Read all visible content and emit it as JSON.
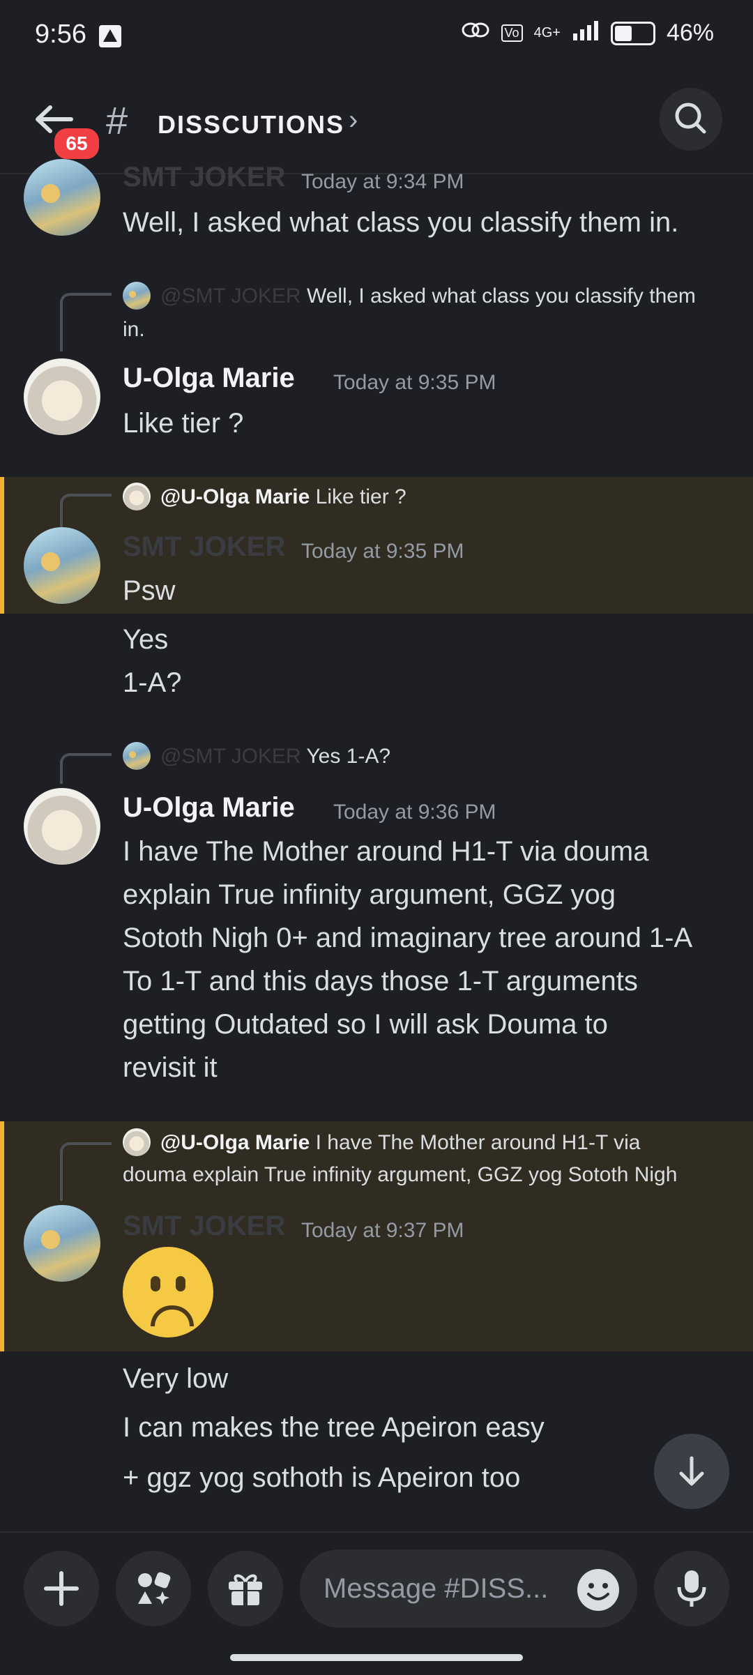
{
  "status_bar": {
    "time": "9:56",
    "network": "4G+",
    "battery_pct": "46%",
    "battery_level": 0.46
  },
  "header": {
    "channel": "DISSCUTIONS",
    "unread_badge": "65",
    "hash": "#"
  },
  "messages": [
    {
      "author": "SMT JOKER",
      "time": "Today at 9:34 PM",
      "lines": [
        "Well, I asked what class you classify them in."
      ]
    },
    {
      "reply_to": "@SMT JOKER",
      "reply_text": "Well, I asked what class you classify them",
      "reply_text2": "in.",
      "author": "U-Olga Marie",
      "time": "Today at 9:35 PM",
      "lines": [
        "Like tier ?"
      ]
    },
    {
      "reply_to": "@U-Olga Marie",
      "reply_text": "Like tier ?",
      "author": "SMT JOKER",
      "time": "Today at 9:35 PM",
      "lines": [
        "Psw",
        "Yes",
        "1-A?"
      ]
    },
    {
      "reply_to": "@SMT JOKER",
      "reply_text": "Yes 1-A?",
      "author": "U-Olga Marie",
      "time": "Today at 9:36 PM",
      "lines": [
        "I have The Mother around H1-T via douma",
        "explain True infinity argument, GGZ yog",
        "Sototh Nigh 0+ and imaginary tree around 1-A",
        "To 1-T and this days those 1-T arguments",
        "getting Outdated so I will ask Douma to",
        "revisit it"
      ]
    },
    {
      "reply_to": "@U-Olga Marie",
      "reply_text": "I have The Mother around H1-T via",
      "reply_text2": "douma explain True infinity argument, GGZ yog Sototh Nigh",
      "author": "SMT JOKER",
      "time": "Today at 9:37 PM",
      "lines": [
        "Very low",
        "I can makes the tree Apeiron easy",
        "+ ggz yog sothoth is Apeiron too"
      ]
    }
  ],
  "input": {
    "placeholder": "Message #DISS..."
  },
  "icons": {
    "back": "arrow-left-icon",
    "search": "search-icon",
    "add": "plus-icon",
    "apps": "apps-icon",
    "gift": "gift-icon",
    "emoji": "emoji-icon",
    "mic": "microphone-icon",
    "scroll": "arrow-down-icon"
  }
}
